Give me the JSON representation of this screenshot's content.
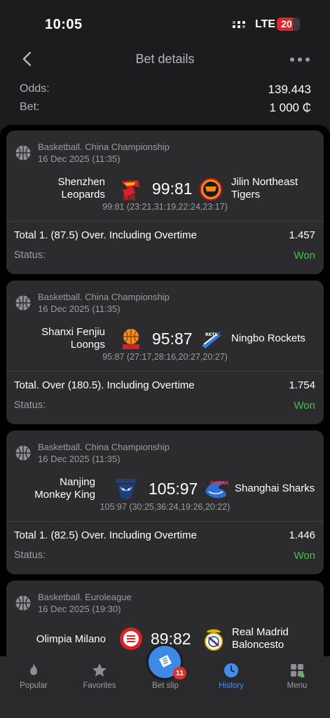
{
  "status_bar": {
    "time": "10:05",
    "network": "LTE",
    "battery": "20"
  },
  "header": {
    "title": "Bet details"
  },
  "summary": {
    "odds_label": "Odds:",
    "odds_value": "139.443",
    "bet_label": "Bet:",
    "bet_value": "1 000 ₵"
  },
  "bets": [
    {
      "league": "Basketball. China Championship",
      "date": "16 Dec 2025 (11:35)",
      "home": "Shenzhen\nLeopards",
      "away": "Jilin Northeast\nTigers",
      "score": "99:81",
      "periods": "99:81 (23:21,31:19,22:24,23:17)",
      "pick": "Total 1. (87.5) Over. Including Overtime",
      "odd": "1.457",
      "status_label": "Status:",
      "status": "Won"
    },
    {
      "league": "Basketball. China Championship",
      "date": "16 Dec 2025 (11:35)",
      "home": "Shanxi Fenjiu\nLoongs",
      "away": "Ningbo Rockets",
      "score": "95:87",
      "periods": "95:87 (27:17,28:16,20:27,20:27)",
      "pick": "Total. Over (180.5). Including Overtime",
      "odd": "1.754",
      "status_label": "Status:",
      "status": "Won"
    },
    {
      "league": "Basketball. China Championship",
      "date": "16 Dec 2025 (11:35)",
      "home": "Nanjing\nMonkey King",
      "away": "Shanghai Sharks",
      "score": "105:97",
      "periods": "105:97 (30:25,36:24,19:26,20:22)",
      "pick": "Total 1. (82.5) Over. Including Overtime",
      "odd": "1.446",
      "status_label": "Status:",
      "status": "Won"
    },
    {
      "league": "Basketball. Euroleague",
      "date": "16 Dec 2025 (19:30)",
      "home": "Olimpia Milano",
      "away": "Real Madrid\nBaloncesto",
      "score": "89:82"
    }
  ],
  "tabs": [
    {
      "label": "Popular",
      "icon": "fire-icon"
    },
    {
      "label": "Favorites",
      "icon": "star-icon"
    },
    {
      "label": "Bet slip",
      "icon": "ticket-icon",
      "badge": "11"
    },
    {
      "label": "History",
      "icon": "clock-icon",
      "active": true
    },
    {
      "label": "Menu",
      "icon": "grid-icon"
    }
  ],
  "colors": {
    "accent": "#3f8ef1",
    "won": "#3ec44a",
    "badge": "#e2302b",
    "card": "#2c2c2e"
  }
}
